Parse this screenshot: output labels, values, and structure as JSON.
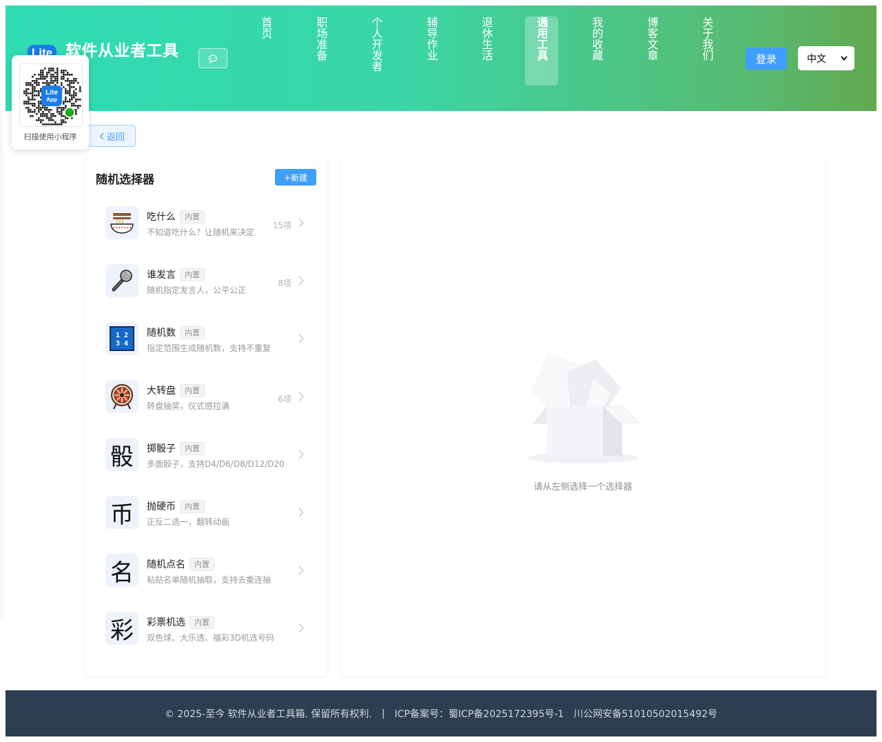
{
  "header": {
    "logo_text": "Lite",
    "site_title": "软件从业者工具",
    "nav": [
      {
        "label": "首页",
        "active": false
      },
      {
        "label": "职场准备",
        "active": false
      },
      {
        "label": "个人开发者",
        "active": false
      },
      {
        "label": "辅导作业",
        "active": false
      },
      {
        "label": "退休生活",
        "active": false
      },
      {
        "label": "通用工具",
        "active": true
      },
      {
        "label": "我的收藏",
        "active": false
      },
      {
        "label": "博客文章",
        "active": false
      },
      {
        "label": "关于我们",
        "active": false
      }
    ],
    "login_label": "登录",
    "language": "中文"
  },
  "qr_popup": {
    "caption": "扫描使用小程序",
    "logo_line1": "Lite",
    "logo_line2": "App"
  },
  "back_label": "返回",
  "selector_list": {
    "title": "随机选择器",
    "new_label": "+新建",
    "items": [
      {
        "name": "吃什么",
        "tag": "内置",
        "desc": "不知道吃什么？让随机来决定",
        "count": "15项",
        "icon": "noodle-bowl-icon"
      },
      {
        "name": "谁发言",
        "tag": "内置",
        "desc": "随机指定发言人，公平公正",
        "count": "8项",
        "icon": "microphone-icon"
      },
      {
        "name": "随机数",
        "tag": "内置",
        "desc": "指定范围生成随机数，支持不重复",
        "count": "",
        "icon": "numbers-icon",
        "icon_line1": "1 2",
        "icon_line2": "3 4"
      },
      {
        "name": "大转盘",
        "tag": "内置",
        "desc": "转盘抽奖，仪式感拉满",
        "count": "6项",
        "icon": "wheel-icon"
      },
      {
        "name": "掷骰子",
        "tag": "内置",
        "desc": "多面骰子，支持D4/D6/D8/D12/D20",
        "count": "",
        "icon": "dice-char-icon",
        "icon_char": "骰"
      },
      {
        "name": "抛硬币",
        "tag": "内置",
        "desc": "正反二选一，翻转动画",
        "count": "",
        "icon": "coin-char-icon",
        "icon_char": "币"
      },
      {
        "name": "随机点名",
        "tag": "内置",
        "desc": "粘贴名单随机抽取，支持去重连抽",
        "count": "",
        "icon": "name-char-icon",
        "icon_char": "名"
      },
      {
        "name": "彩票机选",
        "tag": "内置",
        "desc": "双色球、大乐透、福彩3D机选号码",
        "count": "",
        "icon": "lottery-char-icon",
        "icon_char": "彩"
      }
    ]
  },
  "detail": {
    "empty_text": "请从左侧选择一个选择器"
  },
  "footer": {
    "copyright": "© 2025-至今 软件从业者工具箱. 保留所有权利.",
    "separator": "|",
    "icp": "ICP备案号：蜀ICP备2025172395号-1",
    "police": "川公网安备51010502015492号"
  },
  "colors": {
    "header_gradient_start": "#2edcb4",
    "header_gradient_end": "#62a950",
    "primary": "#409eff",
    "footer_bg": "#2c3e50"
  }
}
